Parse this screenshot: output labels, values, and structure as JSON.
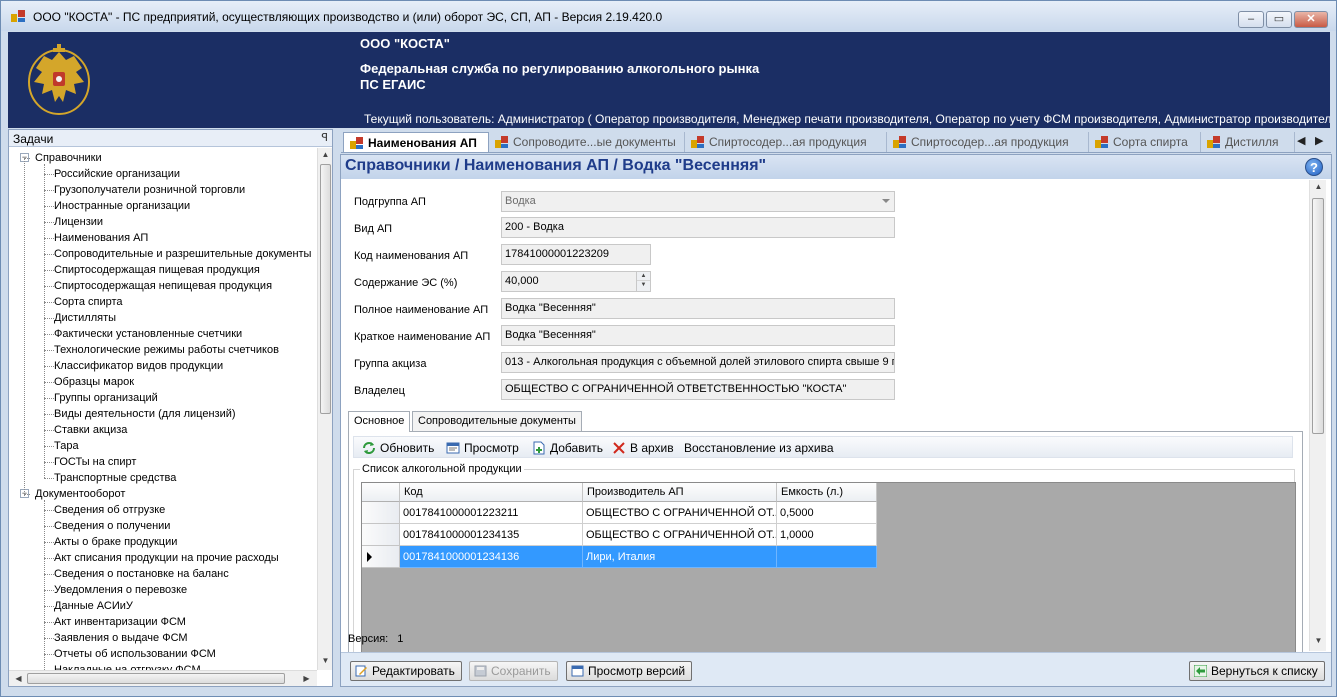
{
  "window": {
    "title": "ООО \"КОСТА\" - ПС предприятий, осуществляющих производство и (или) оборот ЭС, СП, АП - Версия 2.19.420.0",
    "controls": {
      "minimize": "‒",
      "maximize": "▭",
      "close": "✕"
    }
  },
  "banner": {
    "org": "ООО \"КОСТА\"",
    "agency": "Федеральная служба по регулированию алкогольного рынка",
    "system": "ПС ЕГАИС",
    "user": "Текущий пользователь: Администратор ( Оператор производителя, Менеджер печати производителя, Оператор по учету ФСМ производителя, Администратор производителя, Оператор ..."
  },
  "tasks": {
    "header": "Задачи",
    "pin": "ꟼ",
    "groups": [
      {
        "label": "Справочники",
        "expander": "−",
        "items": [
          "Российские организации",
          "Грузополучатели розничной торговли",
          "Иностранные организации",
          "Лицензии",
          "Наименования АП",
          "Сопроводительные и разрешительные документы",
          "Спиртосодержащая пищевая продукция",
          "Спиртосодержащая непищевая продукция",
          "Сорта спирта",
          "Дистилляты",
          "Фактически установленные счетчики",
          "Технологические режимы работы счетчиков",
          "Классификатор видов продукции",
          "Образцы марок",
          "Группы организаций",
          "Виды деятельности (для лицензий)",
          "Ставки акциза",
          "Тара",
          "ГОСТы на спирт",
          "Транспортные средства"
        ]
      },
      {
        "label": "Документооборот",
        "expander": "−",
        "items": [
          "Сведения об отгрузке",
          "Сведения о получении",
          "Акты о браке продукции",
          "Акт списания продукции на прочие расходы",
          "Сведения о постановке на баланс",
          "Уведомления о перевозке",
          "Данные АСИиУ",
          "Акт инвентаризации ФСМ",
          "Заявления о выдаче ФСМ",
          "Отчеты об использовании ФСМ",
          "Накладные на отгрузку ФСМ"
        ]
      }
    ]
  },
  "doc_tabs": [
    {
      "label": "Наименования АП",
      "active": true
    },
    {
      "label": "Сопроводите...ые документы",
      "active": false
    },
    {
      "label": "Спиртосодер...ая продукция",
      "active": false
    },
    {
      "label": "Спиртосодер...ая продукция",
      "active": false
    },
    {
      "label": "Сорта спирта",
      "active": false
    },
    {
      "label": "Дистилля",
      "active": false
    }
  ],
  "doc_tab_nav": {
    "prev": "◀",
    "next": "▶"
  },
  "breadcrumb": "Справочники /  Наименования АП / Водка \"Весенняя\"",
  "help": "?",
  "form": {
    "subgroup": {
      "label": "Подгруппа АП",
      "value": "Водка"
    },
    "kind": {
      "label": "Вид АП",
      "value": "200 - Водка"
    },
    "code": {
      "label": "Код наименования АП",
      "value": "17841000001223209"
    },
    "content": {
      "label": "Содержание ЭС (%)",
      "value": "40,000"
    },
    "full_name": {
      "label": "Полное наименование АП",
      "value": "Водка \"Весенняя\""
    },
    "short_name": {
      "label": "Краткое наименование АП",
      "value": "Водка \"Весенняя\""
    },
    "excise_group": {
      "label": "Группа акциза",
      "value": "013 - Алкогольная продукция с объемной долей этилового спирта свыше 9 п"
    },
    "owner": {
      "label": "Владелец",
      "value": "ОБЩЕСТВО С ОГРАНИЧЕННОЙ ОТВЕТСТВЕННОСТЬЮ \"КОСТА\""
    }
  },
  "sub_tabs": [
    {
      "label": "Основное",
      "active": true
    },
    {
      "label": "Сопроводительные документы",
      "active": false
    }
  ],
  "toolbar": {
    "refresh": "Обновить",
    "view": "Просмотр",
    "add": "Добавить",
    "archive": "В архив",
    "restore": "Восстановление из архива"
  },
  "product_list": {
    "caption": "Список алкогольной продукции",
    "columns": [
      "Код",
      "Производитель АП",
      "Емкость (л.)"
    ],
    "rows": [
      {
        "code": "0017841000001223211",
        "producer": "ОБЩЕСТВО С ОГРАНИЧЕННОЙ ОТ...",
        "volume": "0,5000",
        "selected": false
      },
      {
        "code": "0017841000001234135",
        "producer": "ОБЩЕСТВО С ОГРАНИЧЕННОЙ ОТ...",
        "volume": "1,0000",
        "selected": false
      },
      {
        "code": "0017841000001234136",
        "producer": "Лири, Италия",
        "volume": "",
        "selected": true
      }
    ]
  },
  "version": {
    "label": "Версия:",
    "value": "1"
  },
  "buttons": {
    "edit": "Редактировать",
    "save": "Сохранить",
    "versions": "Просмотр версий",
    "back": "Вернуться к списку"
  },
  "colors": {
    "banner_bg": "#1b2e64",
    "breadcrumb_text": "#1f3c8a",
    "selection": "#3399ff"
  }
}
